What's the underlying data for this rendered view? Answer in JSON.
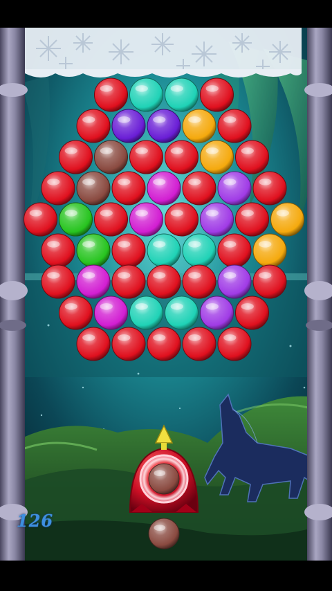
{
  "game": {
    "score": "126",
    "current_ball_color": "brown",
    "next_ball_color": "brown"
  },
  "colors": {
    "red": "#e0101e",
    "teal": "#1fd2b6",
    "purple": "#6a1ed6",
    "orange": "#f5a90d",
    "brown": "#8a4a40",
    "magenta": "#d21ed2",
    "violet": "#a03be6",
    "green": "#27c41f",
    "shooter": "#d8102a",
    "aim_arrow": "#f0e040",
    "frame": "#8d8aa6"
  },
  "bubble_grid": [
    [
      "red",
      "teal",
      "teal",
      "red"
    ],
    [
      "red",
      "purple",
      "purple",
      "orange",
      "red"
    ],
    [
      "red",
      "brown",
      "red",
      "red",
      "orange",
      "red"
    ],
    [
      "red",
      "brown",
      "red",
      "magenta",
      "red",
      "violet",
      "red"
    ],
    [
      "red",
      "green",
      "red",
      "magenta",
      "red",
      "violet",
      "red",
      "orange"
    ],
    [
      "red",
      "green",
      "red",
      "teal",
      "teal",
      "red",
      "orange"
    ],
    [
      "red",
      "magenta",
      "red",
      "red",
      "red",
      "violet",
      "red"
    ],
    [
      "red",
      "magenta",
      "teal",
      "teal",
      "violet",
      "red"
    ],
    [
      "red",
      "red",
      "red",
      "red",
      "red"
    ]
  ]
}
